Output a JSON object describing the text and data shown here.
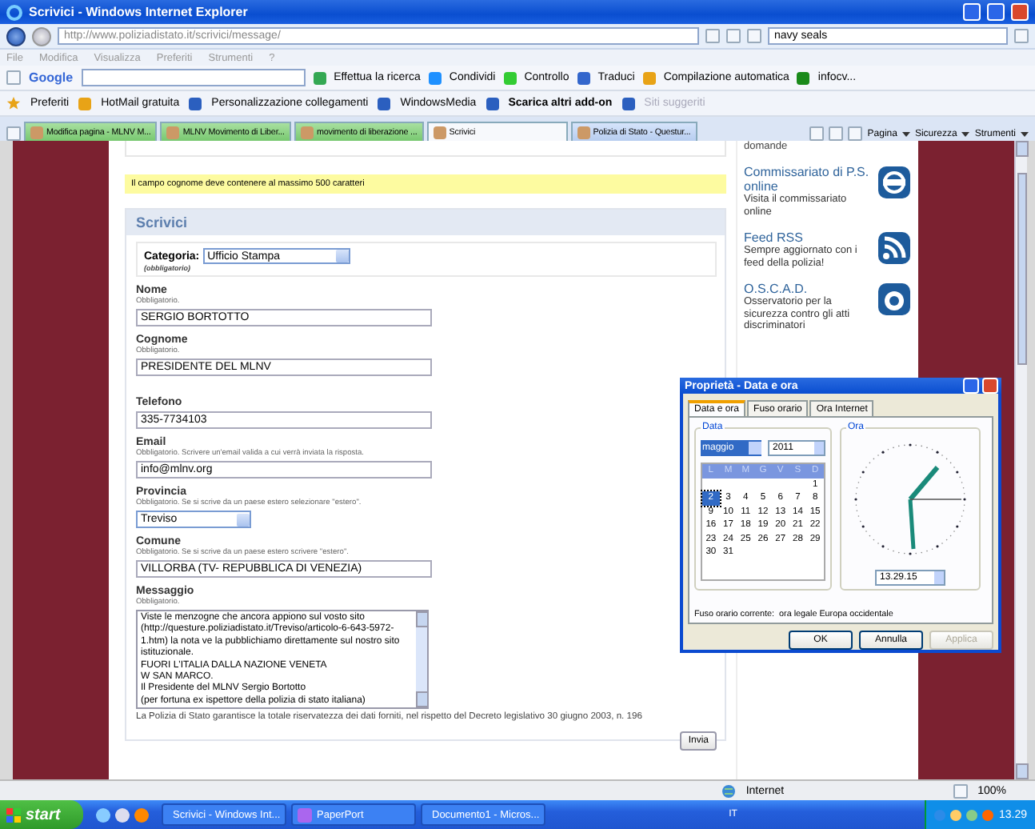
{
  "window": {
    "title": "Scrivici - Windows Internet Explorer"
  },
  "address_bar": {
    "url": "http://www.poliziadistato.it/scrivici/message/",
    "search_value": "navy seals"
  },
  "menu": [
    "File",
    "Modifica",
    "Visualizza",
    "Preferiti",
    "Strumenti",
    "?"
  ],
  "google_toolbar": {
    "logo": "Google",
    "items": [
      "Effettua la ricerca",
      "Condividi",
      "Controllo",
      "Traduci",
      "Compilazione automatica",
      "infocv..."
    ]
  },
  "favorites_bar": [
    {
      "label": "Preferiti",
      "bold": false,
      "disabled": false
    },
    {
      "label": "HotMail gratuita",
      "bold": false,
      "disabled": false
    },
    {
      "label": "Personalizzazione collegamenti",
      "bold": false,
      "disabled": false
    },
    {
      "label": "WindowsMedia",
      "bold": false,
      "disabled": false
    },
    {
      "label": "Scarica altri add-on",
      "bold": true,
      "disabled": false
    },
    {
      "label": "Siti suggeriti",
      "bold": false,
      "disabled": true
    }
  ],
  "tabs": [
    {
      "label": "Modifica pagina - MLNV M...",
      "selected": false
    },
    {
      "label": "MLNV Movimento di Liber...",
      "selected": false
    },
    {
      "label": "movimento di liberazione ...",
      "selected": false
    },
    {
      "label": "Scrivici",
      "selected": true
    },
    {
      "label": "Polizia di Stato - Questur...",
      "selected": false
    }
  ],
  "command_bar": [
    "Pagina",
    "Sicurezza",
    "Strumenti"
  ],
  "page": {
    "alert": "Il campo cognome deve contenere al massimo 500 caratteri",
    "form_title": "Scrivici",
    "category": {
      "label": "Categoria:",
      "value": "Ufficio Stampa",
      "note": "(obbligatorio)"
    },
    "fields": [
      {
        "kind": "text",
        "label": "Nome",
        "hint": "Obbligatorio.",
        "value": "SERGIO BORTOTTO"
      },
      {
        "kind": "text",
        "label": "Cognome",
        "hint": "Obbligatorio.",
        "value": "PRESIDENTE DEL MLNV"
      },
      {
        "kind": "text",
        "label": "Telefono",
        "value": "335-7734103"
      },
      {
        "kind": "text",
        "label": "Email",
        "hint": "Obbligatorio. Scrivere un'email valida a cui verrà inviata la risposta.",
        "value": "info@mlnv.org"
      },
      {
        "kind": "select",
        "label": "Provincia",
        "hint": "Obbligatorio. Se si scrive da un paese estero selezionare \"estero\".",
        "value": "Treviso"
      },
      {
        "kind": "text",
        "label": "Comune",
        "hint": "Obbligatorio. Se si scrive da un paese estero scrivere \"estero\".",
        "value": "VILLORBA (TV- REPUBBLICA DI VENEZIA)"
      },
      {
        "kind": "textarea",
        "label": "Messaggio",
        "hint": "Obbligatorio.",
        "lines": [
          "Viste le menzogne che ancora appiono sul vosto sito",
          "(http://questure.poliziadistato.it/Treviso/articolo-6-643-5972-",
          "1.htm) la nota ve la pubblichiamo direttamente sul nostro sito",
          "istituzionale.",
          "FUORI L'ITALIA DALLA NAZIONE VENETA",
          "W SAN MARCO.",
          "Il Presidente del MLNV Sergio Bortotto",
          "(per fortuna ex ispettore della polizia di stato italiana)"
        ]
      }
    ],
    "privacy": "La Polizia di Stato garantisce la totale riservatezza dei dati forniti, nel rispetto del Decreto legislativo 30 giugno 2003, n. 196",
    "submit": "Invia",
    "sidebar_top": "domande",
    "sidebar": [
      {
        "kind": "badge",
        "title": "Commissariato di P.S. online",
        "text": "Visita il commissariato online"
      },
      {
        "kind": "rss",
        "title": "Feed RSS",
        "text": "Sempre aggiornato con i feed della polizia!"
      },
      {
        "kind": "oscad",
        "title": "O.S.C.A.D.",
        "text": "Osservatorio per la sicurezza contro gli atti discriminatori"
      }
    ]
  },
  "status_bar": {
    "zone": "Internet",
    "zoom": "100%"
  },
  "dialog": {
    "title": "Proprietà - Data e ora",
    "tabs": [
      {
        "label": "Data e ora",
        "selected": true
      },
      {
        "label": "Fuso orario",
        "selected": false
      },
      {
        "label": "Ora Internet",
        "selected": false
      }
    ],
    "date_group": "Data",
    "month": "maggio",
    "year": "2011",
    "weekdays": [
      "L",
      "M",
      "M",
      "G",
      "V",
      "S",
      "D"
    ],
    "days": [
      {
        "day": "1",
        "selected": false
      },
      {
        "day": "2",
        "selected": true
      },
      {
        "day": "3",
        "selected": false
      },
      {
        "day": "4",
        "selected": false
      },
      {
        "day": "5",
        "selected": false
      },
      {
        "day": "6",
        "selected": false
      },
      {
        "day": "7",
        "selected": false
      },
      {
        "day": "8",
        "selected": false
      },
      {
        "day": "9",
        "selected": false
      },
      {
        "day": "10",
        "selected": false
      },
      {
        "day": "11",
        "selected": false
      },
      {
        "day": "12",
        "selected": false
      },
      {
        "day": "13",
        "selected": false
      },
      {
        "day": "14",
        "selected": false
      },
      {
        "day": "15",
        "selected": false
      },
      {
        "day": "16",
        "selected": false
      },
      {
        "day": "17",
        "selected": false
      },
      {
        "day": "18",
        "selected": false
      },
      {
        "day": "19",
        "selected": false
      },
      {
        "day": "20",
        "selected": false
      },
      {
        "day": "21",
        "selected": false
      },
      {
        "day": "22",
        "selected": false
      },
      {
        "day": "23",
        "selected": false
      },
      {
        "day": "24",
        "selected": false
      },
      {
        "day": "25",
        "selected": false
      },
      {
        "day": "26",
        "selected": false
      },
      {
        "day": "27",
        "selected": false
      },
      {
        "day": "28",
        "selected": false
      },
      {
        "day": "29",
        "selected": false
      },
      {
        "day": "30",
        "selected": false
      },
      {
        "day": "31",
        "selected": false
      }
    ],
    "time_group": "Ora",
    "time": "13.29.15",
    "timezone": "Fuso orario corrente:  ora legale Europa occidentale",
    "buttons": [
      {
        "label": "OK",
        "disabled": false
      },
      {
        "label": "Annulla",
        "disabled": false
      },
      {
        "label": "Applica",
        "disabled": true
      }
    ]
  },
  "taskbar": {
    "start": "start",
    "tasks": [
      {
        "label": "Scrivici - Windows Int...",
        "kind": "ie",
        "selected": false
      },
      {
        "label": "PaperPort",
        "kind": "paperport",
        "selected": false
      },
      {
        "label": "Documento1 - Micros...",
        "kind": "word",
        "selected": false
      }
    ],
    "language": "IT",
    "clock": "13.29"
  }
}
